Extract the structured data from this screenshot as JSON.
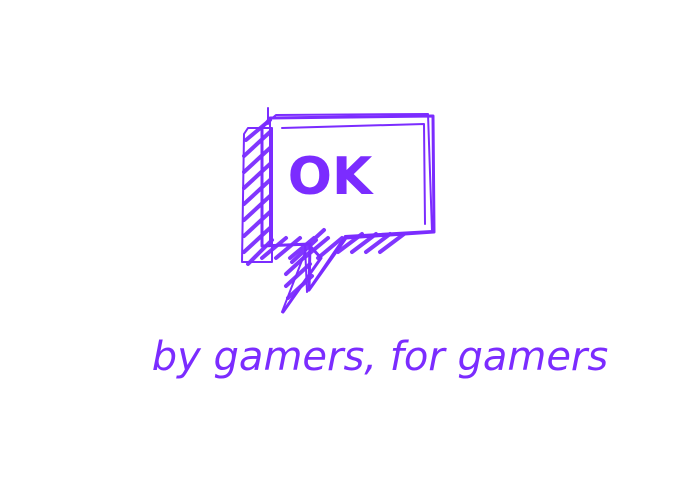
{
  "logo": {
    "text": "OK",
    "color": "#7B2CFF"
  },
  "tagline": {
    "text": "by gamers, for gamers",
    "color": "#7B2CFF"
  }
}
